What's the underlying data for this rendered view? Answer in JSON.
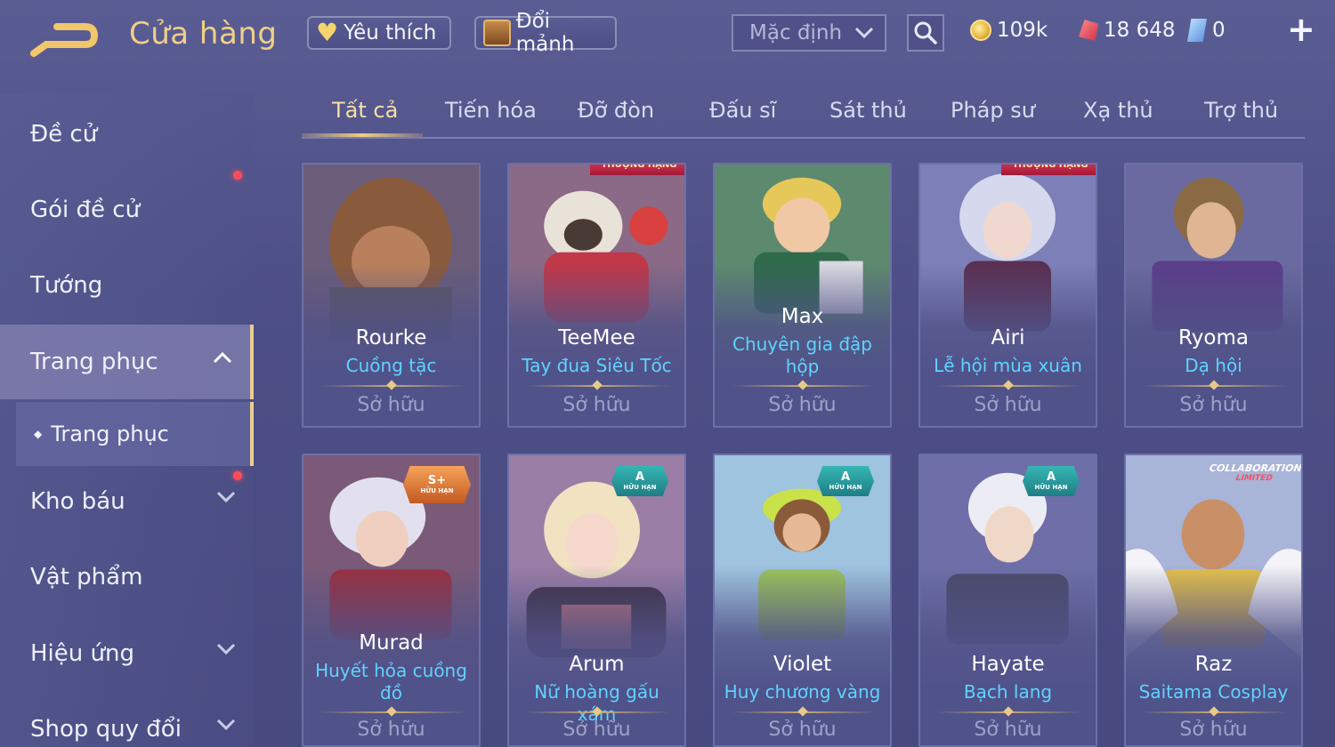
{
  "header": {
    "title": "Cửa hàng",
    "favorites_label": "Yêu thích",
    "exchange_label": "Đổi mảnh",
    "sort_value": "Mặc định",
    "currencies": [
      {
        "name": "gold",
        "value": "109k"
      },
      {
        "name": "ruby",
        "value": "18 648"
      },
      {
        "name": "voucher",
        "value": "0"
      }
    ],
    "plus": "+"
  },
  "sidebar": {
    "items": [
      {
        "label": "Đề cử"
      },
      {
        "label": "Gói đề cử"
      },
      {
        "label": "Tướng"
      },
      {
        "label": "Trang phục"
      },
      {
        "label": "Kho báu"
      },
      {
        "label": "Vật phẩm"
      },
      {
        "label": "Hiệu ứng"
      },
      {
        "label": "Shop quy đổi"
      }
    ],
    "sub_item": "Trang phục",
    "sub_bullet": "◆"
  },
  "tabs": [
    {
      "label": "Tất cả"
    },
    {
      "label": "Tiến hóa"
    },
    {
      "label": "Đỡ đòn"
    },
    {
      "label": "Đấu sĩ"
    },
    {
      "label": "Sát thủ"
    },
    {
      "label": "Pháp sư"
    },
    {
      "label": "Xạ thủ"
    },
    {
      "label": "Trợ thủ"
    }
  ],
  "cards": [
    {
      "hero": "Rourke",
      "skin": "Cuồng tặc",
      "status": "Sở hữu",
      "accent": "#8a5a3c"
    },
    {
      "hero": "TeeMee",
      "skin": "Tay đua Siêu Tốc",
      "status": "Sở hữu",
      "accent": "#c0384a",
      "ribbon": "THƯỢNG HẠNG"
    },
    {
      "hero": "Max",
      "skin": "Chuyên gia đập hộp",
      "status": "Sở hữu",
      "accent": "#4f8b6a"
    },
    {
      "hero": "Airi",
      "skin": "Lễ hội mùa xuân",
      "status": "Sở hữu",
      "accent": "#8f8cc8",
      "ribbon": "THƯỢNG HẠNG"
    },
    {
      "hero": "Ryoma",
      "skin": "Dạ hội",
      "status": "Sở hữu",
      "accent": "#7a64a8"
    },
    {
      "hero": "Murad",
      "skin": "Huyết hỏa cuồng đồ",
      "status": "Sở hữu",
      "accent": "#9a3040",
      "badge": "S+",
      "badge_sub": "HỮU HẠN"
    },
    {
      "hero": "Arum",
      "skin": "Nữ hoàng gấu xám",
      "status": "Sở hữu",
      "accent": "#c27070",
      "badge": "A",
      "badge_sub": "HỮU HẠN"
    },
    {
      "hero": "Violet",
      "skin": "Huy chương vàng",
      "status": "Sở hữu",
      "accent": "#9cc35a",
      "badge": "A",
      "badge_sub": "HỮU HẠN"
    },
    {
      "hero": "Hayate",
      "skin": "Bạch lang",
      "status": "Sở hữu",
      "accent": "#8a8cc0",
      "badge": "A",
      "badge_sub": "HỮU HẠN"
    },
    {
      "hero": "Raz",
      "skin": "Saitama Cosplay",
      "status": "Sở hữu",
      "accent": "#e4c14a",
      "collab": "COLLABORATION",
      "collab_sub": "LIMITED"
    }
  ]
}
